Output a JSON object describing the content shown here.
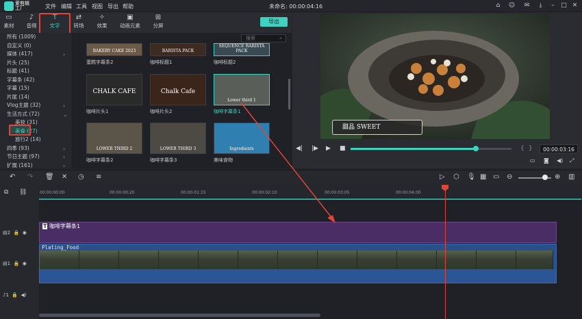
{
  "app": {
    "logo_text": "爱剪辑\n工厂",
    "project_title": "未命名: 00:00:04:16"
  },
  "menu": [
    "文件",
    "编辑",
    "工具",
    "视图",
    "导出",
    "帮助"
  ],
  "toolbar": {
    "tabs": [
      {
        "label": "素材",
        "icon": "folder-icon"
      },
      {
        "label": "音频",
        "icon": "music-icon"
      },
      {
        "label": "文字",
        "icon": "text-icon"
      },
      {
        "label": "转场",
        "icon": "transition-icon"
      },
      {
        "label": "效果",
        "icon": "effects-icon"
      },
      {
        "label": "动画元素",
        "icon": "image-icon"
      },
      {
        "label": "分屏",
        "icon": "split-screen-icon"
      }
    ],
    "export": "导出"
  },
  "sidebar": {
    "items": [
      {
        "label": "所有 (1009)"
      },
      {
        "label": "自定义 (0)"
      },
      {
        "label": "媒体 (417)",
        "arrow": "›"
      },
      {
        "label": "片头 (25)"
      },
      {
        "label": "标题 (41)"
      },
      {
        "label": "字幕条 (42)"
      },
      {
        "label": "字幕 (15)"
      },
      {
        "label": "片尾 (14)"
      },
      {
        "label": "Vlog主题 (32)",
        "arrow": "›"
      },
      {
        "label": "生活方式 (72)",
        "arrow": "⌄"
      },
      {
        "label": "美妆 (31)",
        "sub": true
      },
      {
        "label": "美食 (27)",
        "sub": true,
        "selected": true
      },
      {
        "label": "旅行2 (14)",
        "sub": true
      },
      {
        "label": "四季 (93)",
        "arrow": "›"
      },
      {
        "label": "节日主题 (97)",
        "arrow": "›"
      },
      {
        "label": "扩展 (161)",
        "arrow": "›"
      }
    ]
  },
  "search": {
    "placeholder": "搜索"
  },
  "templates": [
    {
      "label": "蛋糕字幕条2",
      "caption": "BAKERY CAKE 2023"
    },
    {
      "label": "咖啡标题1",
      "caption": "BARISTA PACK"
    },
    {
      "label": "咖啡标题2",
      "caption": "SEQUENCE BARISTA PACK"
    },
    {
      "label": "咖啡片头1",
      "caption": "CHALK CAFE"
    },
    {
      "label": "咖啡片头2",
      "caption": "Chalk Cafe"
    },
    {
      "label": "咖啡字幕条1",
      "caption": "Lower third 1"
    },
    {
      "label": "咖啡字幕条2",
      "caption": "LOWER THIRD 2"
    },
    {
      "label": "咖啡字幕条3",
      "caption": "LOWER THIRD 3"
    },
    {
      "label": "美味食物",
      "caption": "Ingredients"
    }
  ],
  "preview": {
    "overlay_text": "甜品 SWEET",
    "timecode": "00:00:03:16",
    "progress": 0.77
  },
  "timeline": {
    "ruler": [
      "00:00:00:00",
      "00:00:00:20",
      "00:00:01:15",
      "00:00:02:10",
      "00:00:03:05",
      "00:00:04:00"
    ],
    "text_clip": "咖啡字幕条1",
    "video_clip": "Plating_Food",
    "tracks": [
      "2",
      "1"
    ]
  },
  "colors": {
    "accent": "#3fd2c1",
    "highlight": "#e0453a",
    "text_track": "#4b2d65",
    "video_track": "#2a4f8a"
  }
}
